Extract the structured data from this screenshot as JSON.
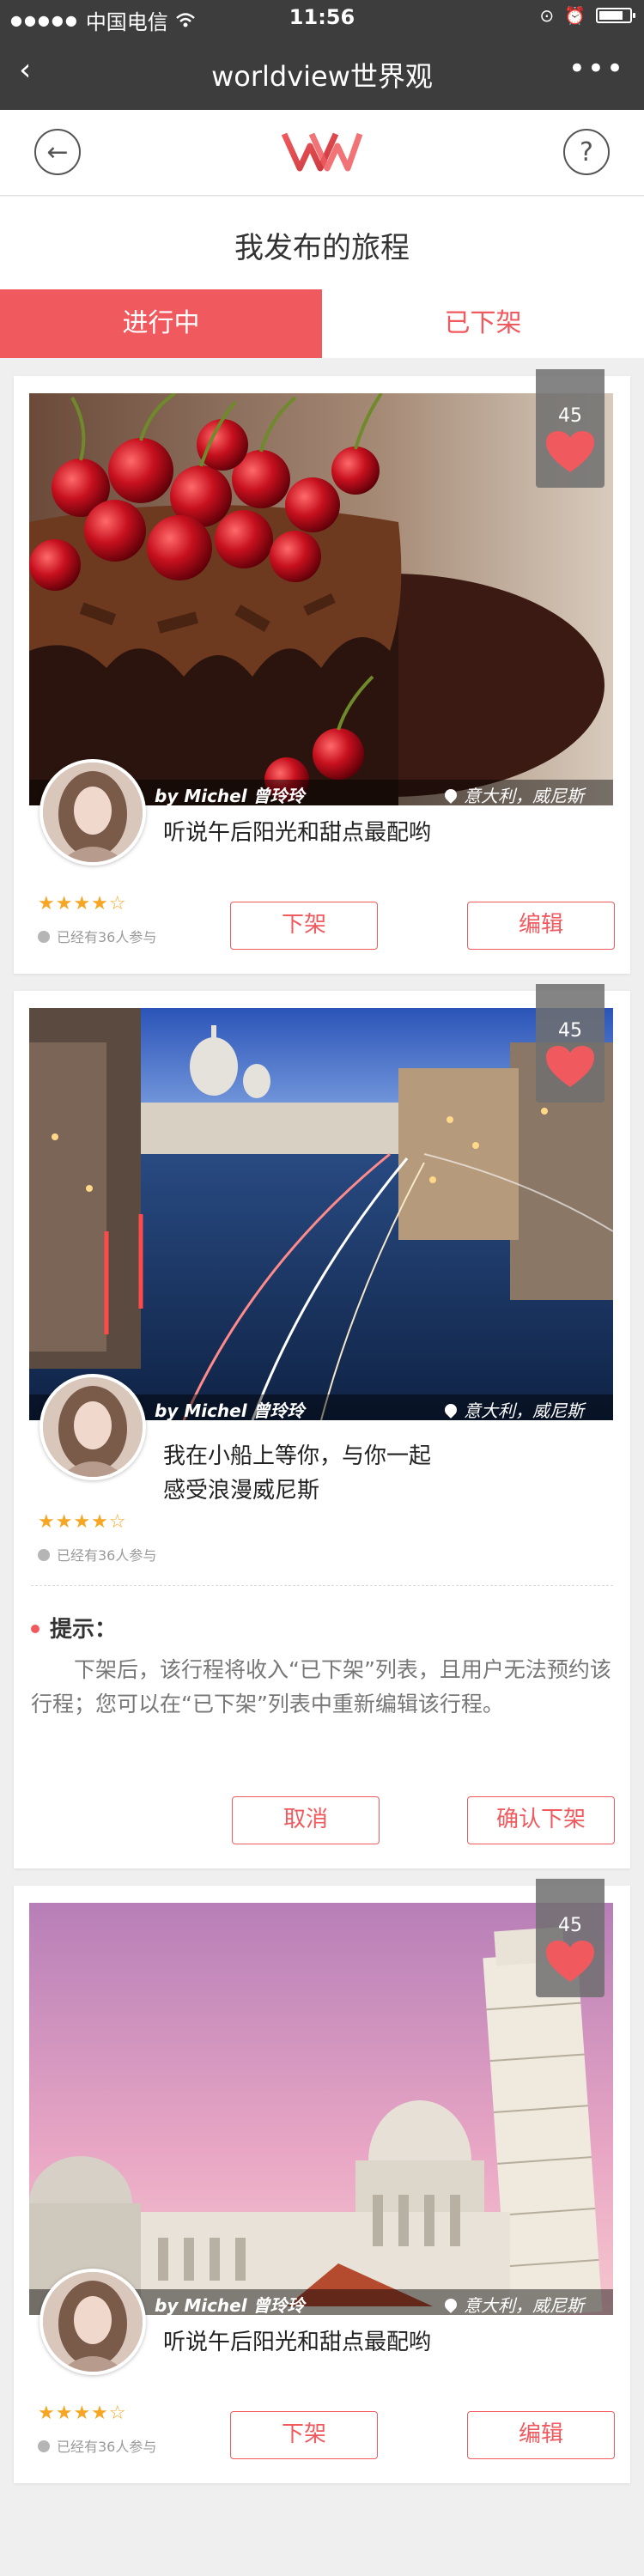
{
  "status_bar": {
    "carrier": "中国电信",
    "time": "11:56",
    "signal_icon": "signal-dots-icon",
    "wifi_icon": "wifi-icon"
  },
  "nav_bar": {
    "title": "worldview世界观",
    "back_glyph": "‹",
    "more_glyph": "•••"
  },
  "header": {
    "back_glyph": "←",
    "help_glyph": "?",
    "logo_icon": "worldview-wv-logo"
  },
  "page_title": "我发布的旅程",
  "tabs": [
    {
      "label": "进行中",
      "active": true
    },
    {
      "label": "已下架",
      "active": false
    }
  ],
  "colors": {
    "accent": "#f05a5e",
    "star": "#f6a623",
    "bar": "#3d3d3d"
  },
  "cards": [
    {
      "image": "cherry-chocolate-cake-photo",
      "likes": "45",
      "author": "by  Michel 曾玲玲",
      "location": "意大利，威尼斯",
      "description_lines": [
        "听说午后阳光和甜点最配哟"
      ],
      "stars": "★★★★☆",
      "rating": 4,
      "participants": "已经有36人参与",
      "buttons": [
        "下架",
        "编辑"
      ]
    },
    {
      "image": "venice-canal-night-photo",
      "likes": "45",
      "author": "by  Michel 曾玲玲",
      "location": "意大利，威尼斯",
      "description_lines": [
        "我在小船上等你，与你一起",
        "感受浪漫威尼斯"
      ],
      "stars": "★★★★☆",
      "rating": 4,
      "participants": "已经有36人参与",
      "tip_title": "提示：",
      "tip_text": "下架后，该行程将收入“已下架”列表，且用户无法预约该行程；您可以在“已下架”列表中重新编辑该行程。",
      "buttons": [
        "取消",
        "确认下架"
      ]
    },
    {
      "image": "pisa-tower-dusk-photo",
      "likes": "45",
      "author": "by  Michel 曾玲玲",
      "location": "意大利，威尼斯",
      "description_lines": [
        "听说午后阳光和甜点最配哟"
      ],
      "stars": "★★★★☆",
      "rating": 4,
      "participants": "已经有36人参与",
      "buttons": [
        "下架",
        "编辑"
      ]
    }
  ]
}
